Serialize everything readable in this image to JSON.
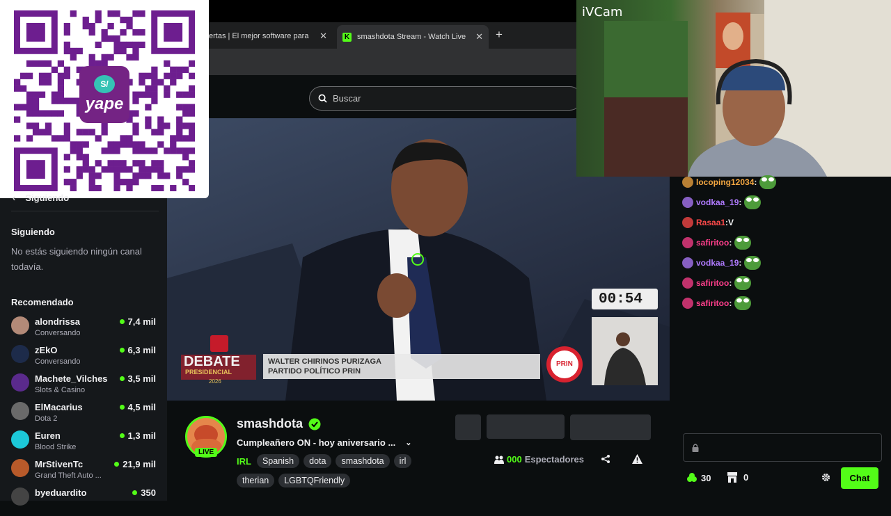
{
  "browser": {
    "tabs": [
      {
        "label": "ertas | El mejor software para"
      },
      {
        "label": "smashdota Stream - Watch Live"
      }
    ],
    "favicon_letter": "K",
    "new_tab": "+"
  },
  "search": {
    "placeholder": "Buscar"
  },
  "webcam": {
    "label": "iVCam"
  },
  "qr": {
    "logo_text": "yape",
    "logo_symbol": "S/"
  },
  "sidebar": {
    "truncated_header": "Siguiendo",
    "following_title": "Siguiendo",
    "following_empty": "No estás siguiendo ningún canal todavía.",
    "recommended_title": "Recomendado",
    "items": [
      {
        "name": "alondrissa",
        "category": "Conversando",
        "viewers": "7,4 mil",
        "color": "#b38a78"
      },
      {
        "name": "zEkO",
        "category": "Conversando",
        "viewers": "6,3 mil",
        "color": "#1d2b4a"
      },
      {
        "name": "Machete_Vilches",
        "category": "Slots & Casino",
        "viewers": "3,5 mil",
        "color": "#5a2a8c"
      },
      {
        "name": "ElMacarius",
        "category": "Dota 2",
        "viewers": "4,5 mil",
        "color": "#6a6a6a"
      },
      {
        "name": "Euren",
        "category": "Blood Strike",
        "viewers": "1,3 mil",
        "color": "#1cc8d8"
      },
      {
        "name": "MrStivenTc",
        "category": "Grand Theft Auto ...",
        "viewers": "21,9 mil",
        "color": "#b85a2a"
      },
      {
        "name": "byeduardito",
        "category": "",
        "viewers": "350",
        "color": "#444"
      }
    ]
  },
  "video": {
    "timer": "00:54",
    "lower_third_name": "WALTER CHIRINOS PURIZAGA",
    "lower_third_party": "PARTIDO POLÍTICO PRIN",
    "debate_label": "DEBATE",
    "debate_sub": "PRESIDENCIAL",
    "debate_year": "2026",
    "party_logo": "PRIN"
  },
  "chat": {
    "messages": [
      {
        "user": "locoping12034",
        "text": "",
        "color": "#f4a742",
        "emote": true
      },
      {
        "user": "vodkaa_19",
        "text": "",
        "color": "#b07bff",
        "emote": true
      },
      {
        "user": "Rasaa1",
        "text": " V",
        "color": "#ff4a4a",
        "emote": false
      },
      {
        "user": "safiritoo",
        "text": "",
        "color": "#ff3f8c",
        "emote": true
      },
      {
        "user": "vodkaa_19",
        "text": "",
        "color": "#b07bff",
        "emote": true
      },
      {
        "user": "safiritoo",
        "text": "",
        "color": "#ff3f8c",
        "emote": true
      },
      {
        "user": "safiritoo",
        "text": "",
        "color": "#ff3f8c",
        "emote": true
      }
    ],
    "points": "30",
    "drops": "0",
    "send_label": "Chat"
  },
  "channel": {
    "name": "smashdota",
    "live_badge": "LIVE",
    "title": "Cumpleañero ON - hoy aniversario ...",
    "category": "IRL",
    "tags": [
      "Spanish",
      "dota",
      "smashdota",
      "irl",
      "therian",
      "LGBTQFriendly"
    ],
    "viewers_count": "000",
    "viewers_label": "Espectadores"
  },
  "colors": {
    "accent": "#53fc18",
    "bg": "#0b0e0f",
    "sidebar": "#15181b"
  }
}
